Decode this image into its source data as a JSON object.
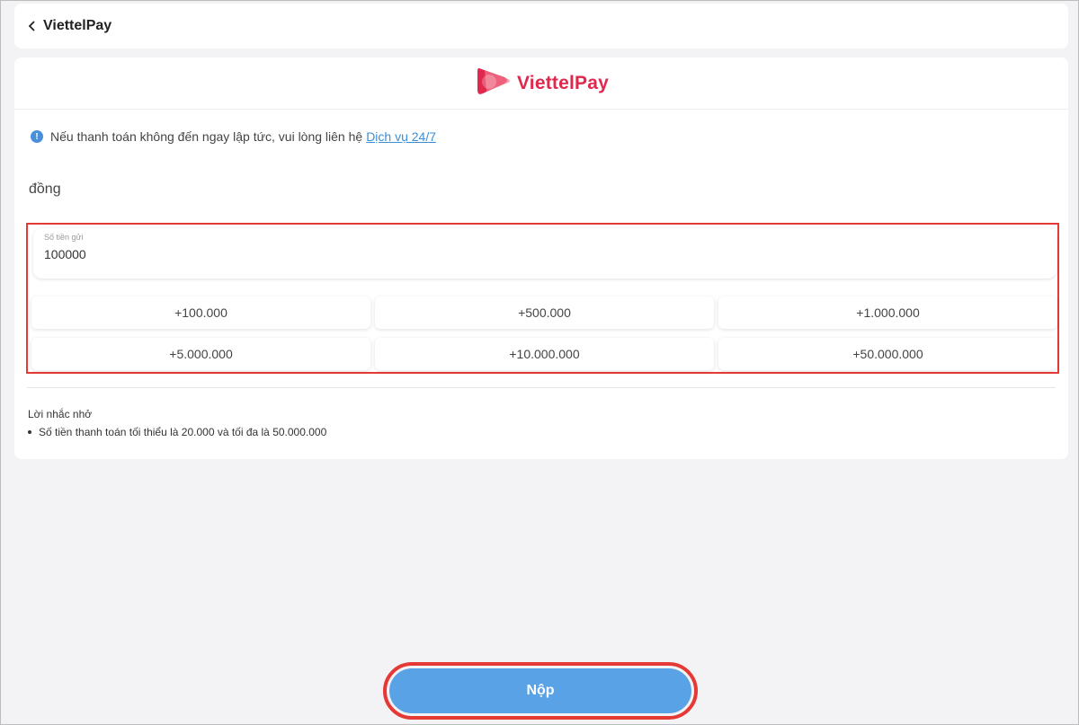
{
  "header": {
    "title": "ViettelPay"
  },
  "logo": {
    "text": "ViettelPay",
    "color": "#e0274d"
  },
  "notice": {
    "text": "Nếu thanh toán không đến ngay lập tức, vui lòng liên hệ",
    "link": "Dịch vụ 24/7"
  },
  "currency": "đồng",
  "amount": {
    "label": "Số tiền gửi",
    "value": "100000"
  },
  "quick_amounts": [
    "+100.000",
    "+500.000",
    "+1.000.000",
    "+5.000.000",
    "+10.000.000",
    "+50.000.000"
  ],
  "reminder": {
    "title": "Lời nhắc nhở",
    "items": [
      "Số tiền thanh toán tối thiểu là 20.000 và tối đa là 50.000.000"
    ]
  },
  "submit": {
    "label": "Nộp",
    "color": "#5aa2e6"
  },
  "icons": {
    "back": "chevron-left-icon",
    "info": "info-icon",
    "logo": "viettelpay-logo-icon"
  }
}
